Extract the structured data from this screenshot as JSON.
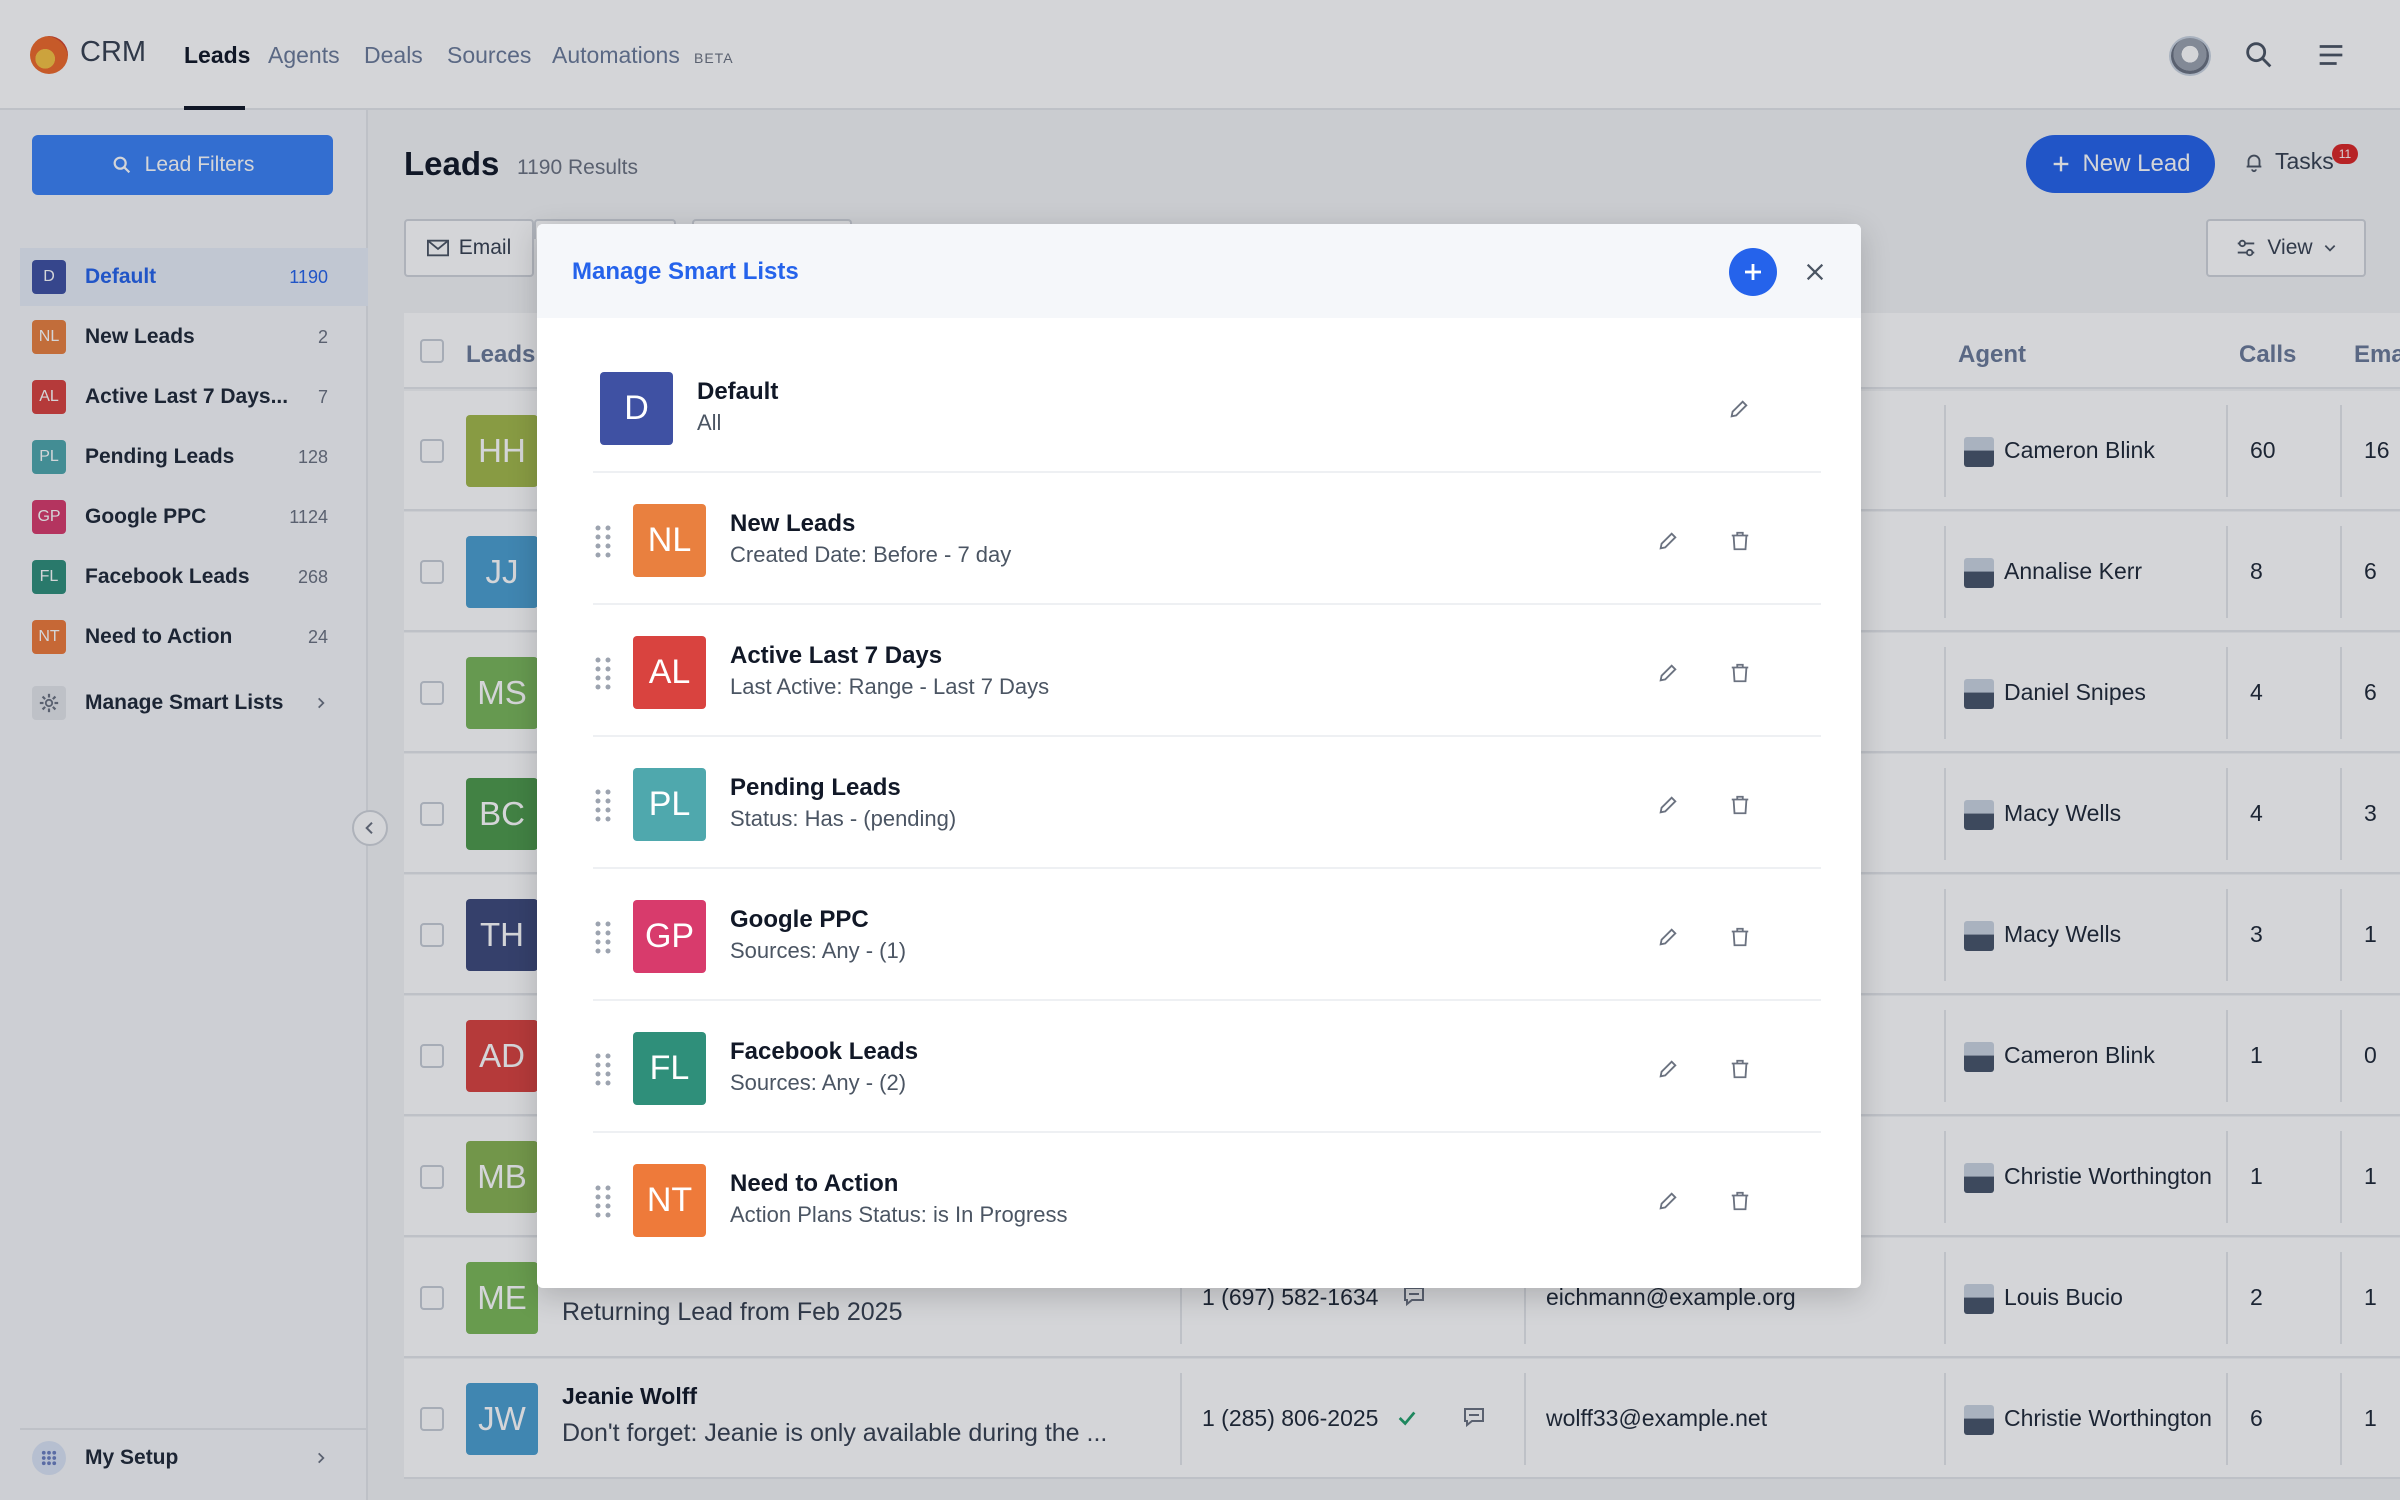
{
  "nav": {
    "brand": "CRM",
    "links": [
      "Leads",
      "Agents",
      "Deals",
      "Sources",
      "Automations"
    ],
    "beta_label": "BETA"
  },
  "sidebar": {
    "filters_label": "Lead Filters",
    "items": [
      {
        "abbr": "D",
        "label": "Default",
        "count": "1190",
        "color": "#3f51a3"
      },
      {
        "abbr": "NL",
        "label": "New Leads",
        "count": "2",
        "color": "#e9803f"
      },
      {
        "abbr": "AL",
        "label": "Active Last 7 Days...",
        "count": "7",
        "color": "#d9433f"
      },
      {
        "abbr": "PL",
        "label": "Pending Leads",
        "count": "128",
        "color": "#4fa8ad"
      },
      {
        "abbr": "GP",
        "label": "Google PPC",
        "count": "1124",
        "color": "#d83b6c"
      },
      {
        "abbr": "FL",
        "label": "Facebook Leads",
        "count": "268",
        "color": "#2f8f7a"
      },
      {
        "abbr": "NT",
        "label": "Need to Action",
        "count": "24",
        "color": "#ee7a3a"
      }
    ],
    "manage_label": "Manage Smart Lists",
    "setup_label": "My Setup"
  },
  "header": {
    "title": "Leads",
    "results": "1190 Results",
    "new_lead": "New Lead",
    "tasks": "Tasks",
    "tasks_count": "11",
    "view": "View",
    "email": "Email"
  },
  "table": {
    "columns": {
      "leads": "Leads,",
      "agent": "Agent",
      "calls": "Calls",
      "emails": "Ema"
    },
    "rows": [
      {
        "initials": "HH",
        "color": "#a3b94a",
        "agent": "Cameron Blink",
        "calls": "60",
        "emails": "16"
      },
      {
        "initials": "JJ",
        "color": "#4b9fd0",
        "agent": "Annalise Kerr",
        "calls": "8",
        "emails": "6"
      },
      {
        "initials": "MS",
        "color": "#79b65a",
        "agent": "Daniel Snipes",
        "calls": "4",
        "emails": "6"
      },
      {
        "initials": "BC",
        "color": "#4e9a4b",
        "agent": "Macy Wells",
        "calls": "4",
        "emails": "3"
      },
      {
        "initials": "TH",
        "color": "#3d4a7a",
        "agent": "Macy Wells",
        "calls": "3",
        "emails": "1"
      },
      {
        "initials": "AD",
        "color": "#d9433f",
        "agent": "Cameron Blink",
        "calls": "1",
        "emails": "0"
      },
      {
        "initials": "MB",
        "color": "#88b352",
        "agent": "Christie Worthington",
        "calls": "1",
        "emails": "1"
      },
      {
        "initials": "ME",
        "color": "#7cb957",
        "name": "",
        "note": "Returning Lead from Feb 2025",
        "phone": "1 (697) 582-1634",
        "email": "eichmann@example.org",
        "agent": "Louis Bucio",
        "calls": "2",
        "emails": "1"
      },
      {
        "initials": "JW",
        "color": "#4b9fd0",
        "name": "Jeanie Wolff",
        "note": "Don't forget: Jeanie is only available during the ...",
        "phone": "1 (285) 806-2025",
        "email": "wolff33@example.net",
        "agent": "Christie Worthington",
        "calls": "6",
        "emails": "1"
      }
    ]
  },
  "modal": {
    "title": "Manage Smart Lists",
    "lists": [
      {
        "abbr": "D",
        "name": "Default",
        "desc": "All",
        "color": "#3f51a3"
      },
      {
        "abbr": "NL",
        "name": "New Leads",
        "desc": "Created Date: Before - 7 day",
        "color": "#e9803f"
      },
      {
        "abbr": "AL",
        "name": "Active Last 7 Days",
        "desc": "Last Active: Range - Last 7 Days",
        "color": "#d9433f"
      },
      {
        "abbr": "PL",
        "name": "Pending Leads",
        "desc": "Status: Has - (pending)",
        "color": "#4fa8ad"
      },
      {
        "abbr": "GP",
        "name": "Google PPC",
        "desc": "Sources: Any - (1)",
        "color": "#d83b6c"
      },
      {
        "abbr": "FL",
        "name": "Facebook Leads",
        "desc": "Sources: Any - (2)",
        "color": "#2f8f7a"
      },
      {
        "abbr": "NT",
        "name": "Need to Action",
        "desc": "Action Plans Status: is In Progress",
        "color": "#ee7a3a"
      }
    ]
  }
}
